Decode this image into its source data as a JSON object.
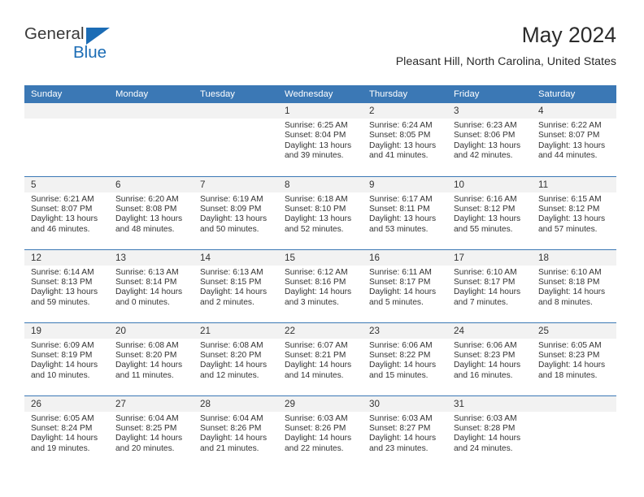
{
  "brand": {
    "name_part1": "General",
    "name_part2": "Blue",
    "logo_icon": "triangle-logo-icon"
  },
  "header": {
    "title": "May 2024",
    "subtitle": "Pleasant Hill, North Carolina, United States"
  },
  "colors": {
    "header_blue": "#3b78b5",
    "row_divider_blue": "#3b78b5",
    "daynum_band": "#f2f2f2",
    "brand_blue": "#1b6cb5",
    "text": "#333333"
  },
  "weekdays": [
    "Sunday",
    "Monday",
    "Tuesday",
    "Wednesday",
    "Thursday",
    "Friday",
    "Saturday"
  ],
  "weeks": [
    [
      {
        "day": "",
        "empty": true
      },
      {
        "day": "",
        "empty": true
      },
      {
        "day": "",
        "empty": true
      },
      {
        "day": "1",
        "sunrise": "Sunrise: 6:25 AM",
        "sunset": "Sunset: 8:04 PM",
        "daylight1": "Daylight: 13 hours",
        "daylight2": "and 39 minutes."
      },
      {
        "day": "2",
        "sunrise": "Sunrise: 6:24 AM",
        "sunset": "Sunset: 8:05 PM",
        "daylight1": "Daylight: 13 hours",
        "daylight2": "and 41 minutes."
      },
      {
        "day": "3",
        "sunrise": "Sunrise: 6:23 AM",
        "sunset": "Sunset: 8:06 PM",
        "daylight1": "Daylight: 13 hours",
        "daylight2": "and 42 minutes."
      },
      {
        "day": "4",
        "sunrise": "Sunrise: 6:22 AM",
        "sunset": "Sunset: 8:07 PM",
        "daylight1": "Daylight: 13 hours",
        "daylight2": "and 44 minutes."
      }
    ],
    [
      {
        "day": "5",
        "sunrise": "Sunrise: 6:21 AM",
        "sunset": "Sunset: 8:07 PM",
        "daylight1": "Daylight: 13 hours",
        "daylight2": "and 46 minutes."
      },
      {
        "day": "6",
        "sunrise": "Sunrise: 6:20 AM",
        "sunset": "Sunset: 8:08 PM",
        "daylight1": "Daylight: 13 hours",
        "daylight2": "and 48 minutes."
      },
      {
        "day": "7",
        "sunrise": "Sunrise: 6:19 AM",
        "sunset": "Sunset: 8:09 PM",
        "daylight1": "Daylight: 13 hours",
        "daylight2": "and 50 minutes."
      },
      {
        "day": "8",
        "sunrise": "Sunrise: 6:18 AM",
        "sunset": "Sunset: 8:10 PM",
        "daylight1": "Daylight: 13 hours",
        "daylight2": "and 52 minutes."
      },
      {
        "day": "9",
        "sunrise": "Sunrise: 6:17 AM",
        "sunset": "Sunset: 8:11 PM",
        "daylight1": "Daylight: 13 hours",
        "daylight2": "and 53 minutes."
      },
      {
        "day": "10",
        "sunrise": "Sunrise: 6:16 AM",
        "sunset": "Sunset: 8:12 PM",
        "daylight1": "Daylight: 13 hours",
        "daylight2": "and 55 minutes."
      },
      {
        "day": "11",
        "sunrise": "Sunrise: 6:15 AM",
        "sunset": "Sunset: 8:12 PM",
        "daylight1": "Daylight: 13 hours",
        "daylight2": "and 57 minutes."
      }
    ],
    [
      {
        "day": "12",
        "sunrise": "Sunrise: 6:14 AM",
        "sunset": "Sunset: 8:13 PM",
        "daylight1": "Daylight: 13 hours",
        "daylight2": "and 59 minutes."
      },
      {
        "day": "13",
        "sunrise": "Sunrise: 6:13 AM",
        "sunset": "Sunset: 8:14 PM",
        "daylight1": "Daylight: 14 hours",
        "daylight2": "and 0 minutes."
      },
      {
        "day": "14",
        "sunrise": "Sunrise: 6:13 AM",
        "sunset": "Sunset: 8:15 PM",
        "daylight1": "Daylight: 14 hours",
        "daylight2": "and 2 minutes."
      },
      {
        "day": "15",
        "sunrise": "Sunrise: 6:12 AM",
        "sunset": "Sunset: 8:16 PM",
        "daylight1": "Daylight: 14 hours",
        "daylight2": "and 3 minutes."
      },
      {
        "day": "16",
        "sunrise": "Sunrise: 6:11 AM",
        "sunset": "Sunset: 8:17 PM",
        "daylight1": "Daylight: 14 hours",
        "daylight2": "and 5 minutes."
      },
      {
        "day": "17",
        "sunrise": "Sunrise: 6:10 AM",
        "sunset": "Sunset: 8:17 PM",
        "daylight1": "Daylight: 14 hours",
        "daylight2": "and 7 minutes."
      },
      {
        "day": "18",
        "sunrise": "Sunrise: 6:10 AM",
        "sunset": "Sunset: 8:18 PM",
        "daylight1": "Daylight: 14 hours",
        "daylight2": "and 8 minutes."
      }
    ],
    [
      {
        "day": "19",
        "sunrise": "Sunrise: 6:09 AM",
        "sunset": "Sunset: 8:19 PM",
        "daylight1": "Daylight: 14 hours",
        "daylight2": "and 10 minutes."
      },
      {
        "day": "20",
        "sunrise": "Sunrise: 6:08 AM",
        "sunset": "Sunset: 8:20 PM",
        "daylight1": "Daylight: 14 hours",
        "daylight2": "and 11 minutes."
      },
      {
        "day": "21",
        "sunrise": "Sunrise: 6:08 AM",
        "sunset": "Sunset: 8:20 PM",
        "daylight1": "Daylight: 14 hours",
        "daylight2": "and 12 minutes."
      },
      {
        "day": "22",
        "sunrise": "Sunrise: 6:07 AM",
        "sunset": "Sunset: 8:21 PM",
        "daylight1": "Daylight: 14 hours",
        "daylight2": "and 14 minutes."
      },
      {
        "day": "23",
        "sunrise": "Sunrise: 6:06 AM",
        "sunset": "Sunset: 8:22 PM",
        "daylight1": "Daylight: 14 hours",
        "daylight2": "and 15 minutes."
      },
      {
        "day": "24",
        "sunrise": "Sunrise: 6:06 AM",
        "sunset": "Sunset: 8:23 PM",
        "daylight1": "Daylight: 14 hours",
        "daylight2": "and 16 minutes."
      },
      {
        "day": "25",
        "sunrise": "Sunrise: 6:05 AM",
        "sunset": "Sunset: 8:23 PM",
        "daylight1": "Daylight: 14 hours",
        "daylight2": "and 18 minutes."
      }
    ],
    [
      {
        "day": "26",
        "sunrise": "Sunrise: 6:05 AM",
        "sunset": "Sunset: 8:24 PM",
        "daylight1": "Daylight: 14 hours",
        "daylight2": "and 19 minutes."
      },
      {
        "day": "27",
        "sunrise": "Sunrise: 6:04 AM",
        "sunset": "Sunset: 8:25 PM",
        "daylight1": "Daylight: 14 hours",
        "daylight2": "and 20 minutes."
      },
      {
        "day": "28",
        "sunrise": "Sunrise: 6:04 AM",
        "sunset": "Sunset: 8:26 PM",
        "daylight1": "Daylight: 14 hours",
        "daylight2": "and 21 minutes."
      },
      {
        "day": "29",
        "sunrise": "Sunrise: 6:03 AM",
        "sunset": "Sunset: 8:26 PM",
        "daylight1": "Daylight: 14 hours",
        "daylight2": "and 22 minutes."
      },
      {
        "day": "30",
        "sunrise": "Sunrise: 6:03 AM",
        "sunset": "Sunset: 8:27 PM",
        "daylight1": "Daylight: 14 hours",
        "daylight2": "and 23 minutes."
      },
      {
        "day": "31",
        "sunrise": "Sunrise: 6:03 AM",
        "sunset": "Sunset: 8:28 PM",
        "daylight1": "Daylight: 14 hours",
        "daylight2": "and 24 minutes."
      },
      {
        "day": "",
        "empty": true
      }
    ]
  ]
}
